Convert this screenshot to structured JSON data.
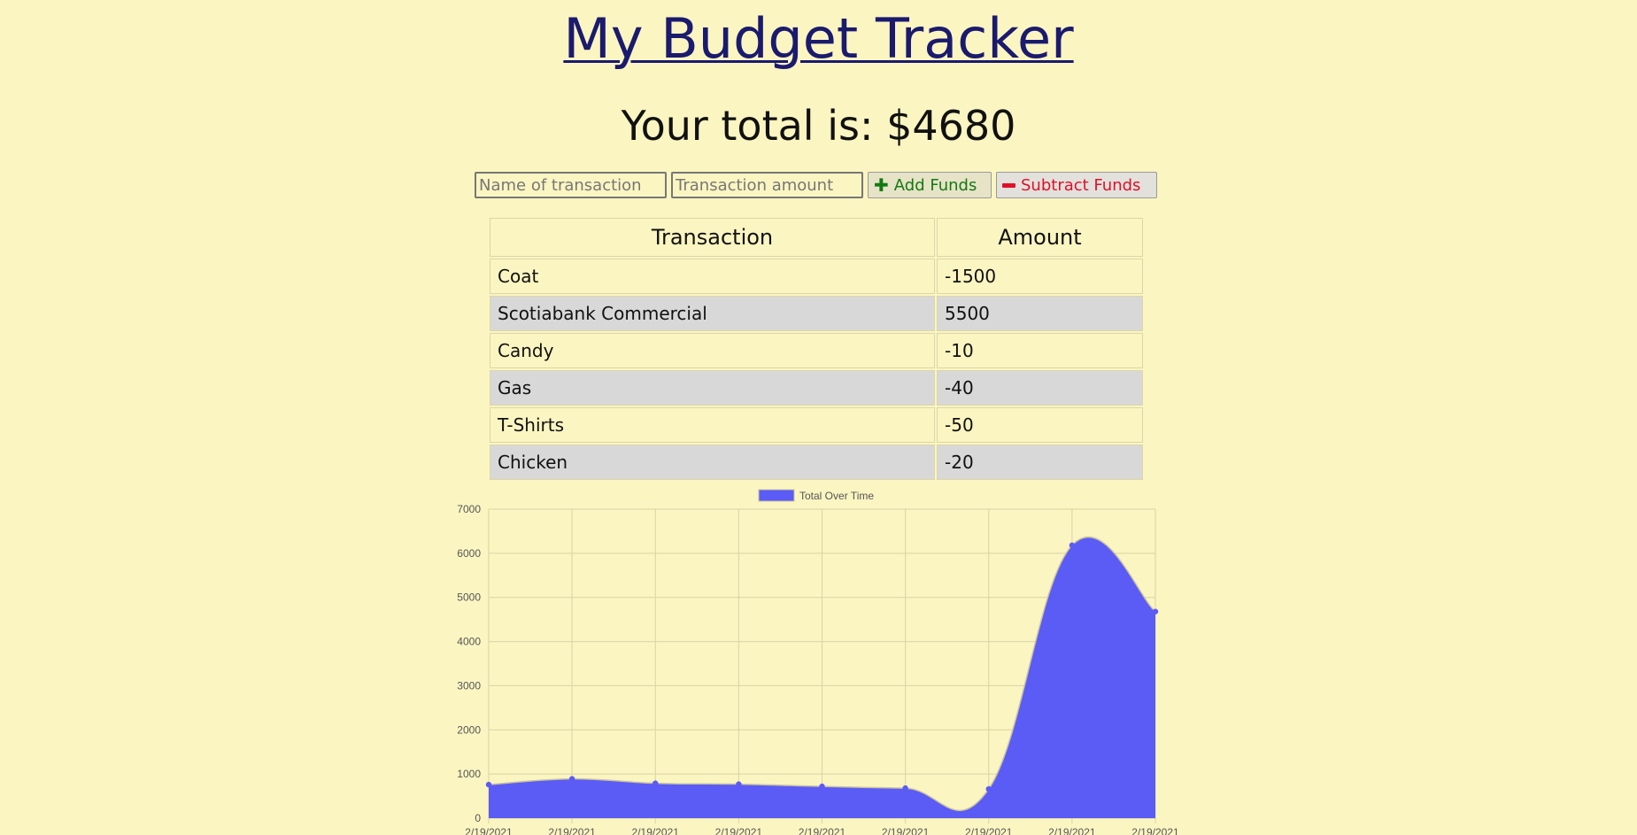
{
  "title": "My Budget Tracker",
  "total_text": "Your total is: $4680",
  "form": {
    "name_placeholder": "Name of transaction",
    "amount_placeholder": "Transaction amount",
    "add_label": "Add Funds",
    "subtract_label": "Subtract Funds"
  },
  "table": {
    "headers": [
      "Transaction",
      "Amount"
    ],
    "rows": [
      {
        "name": "Coat",
        "amount": "-1500"
      },
      {
        "name": "Scotiabank Commercial",
        "amount": "5500"
      },
      {
        "name": "Candy",
        "amount": "-10"
      },
      {
        "name": "Gas",
        "amount": "-40"
      },
      {
        "name": "T-Shirts",
        "amount": "-50"
      },
      {
        "name": "Chicken",
        "amount": "-20"
      }
    ]
  },
  "colors": {
    "background": "#fbf5c1",
    "series_fill": "#5b5bf5",
    "add_green": "#127a12",
    "subtract_red": "#e0102a",
    "title_link": "#1a1a6e"
  },
  "chart_data": {
    "type": "area",
    "legend": "top",
    "grid": true,
    "x": [
      "2/19/2021",
      "2/19/2021",
      "2/19/2021",
      "2/19/2021",
      "2/19/2021",
      "2/19/2021",
      "2/19/2021",
      "2/19/2021",
      "2/19/2021"
    ],
    "series": [
      {
        "name": "Total Over Time",
        "values": [
          760,
          890,
          790,
          770,
          720,
          680,
          660,
          6180,
          4680
        ]
      }
    ],
    "yticks": [
      0,
      1000,
      2000,
      3000,
      4000,
      5000,
      6000,
      7000
    ],
    "ylim": [
      0,
      7000
    ]
  }
}
